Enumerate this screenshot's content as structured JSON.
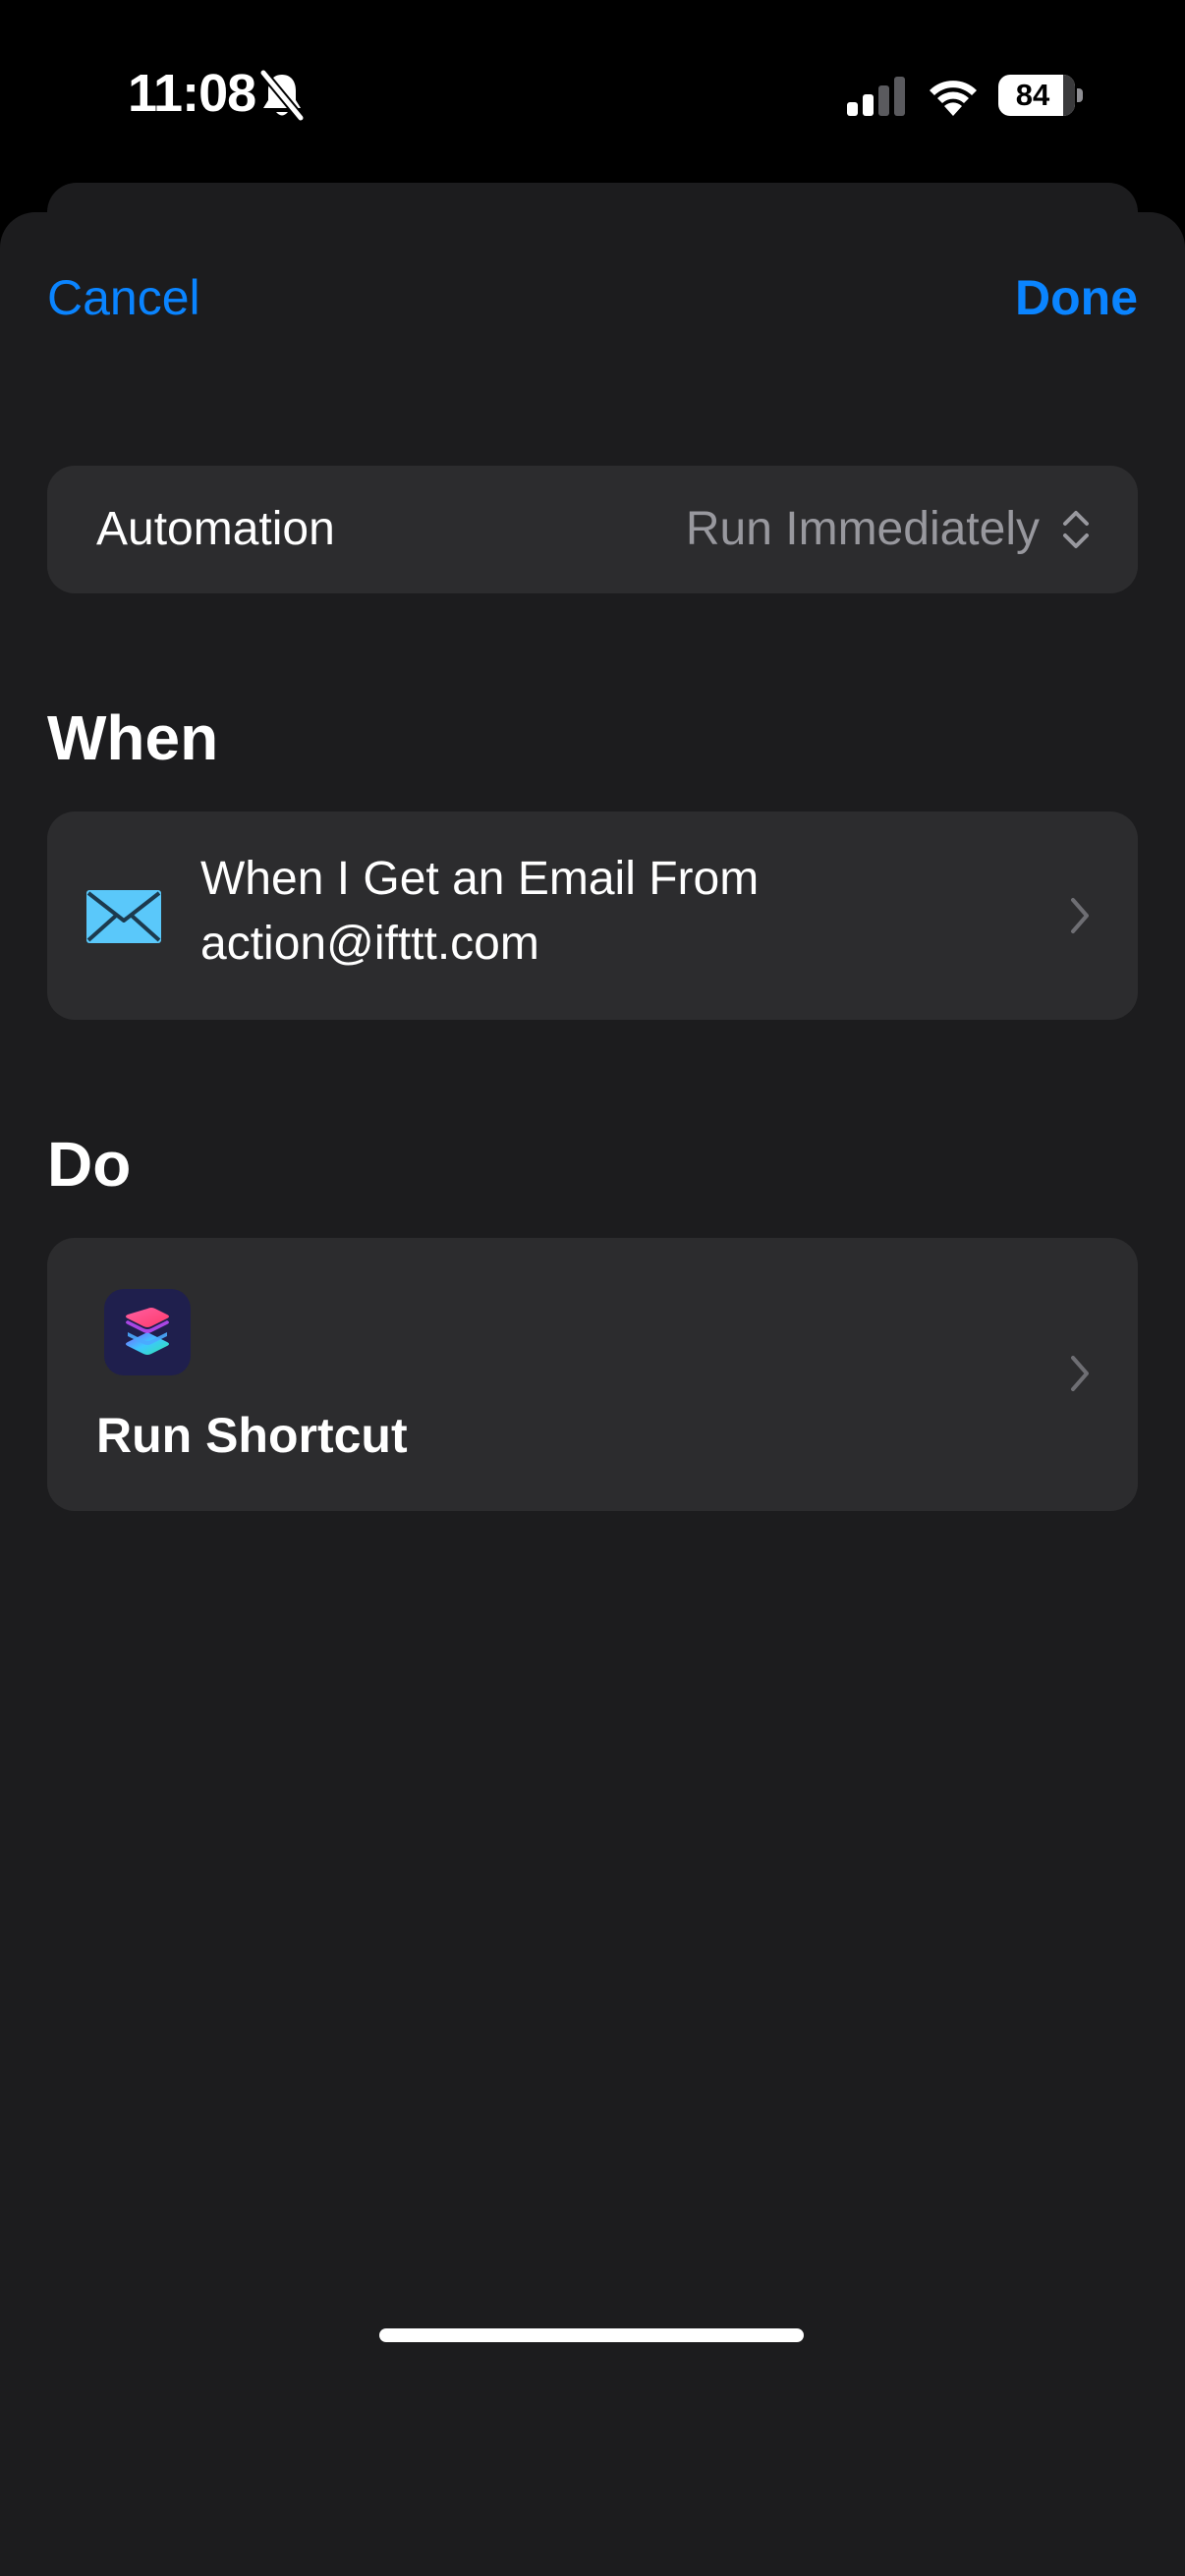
{
  "status_bar": {
    "time": "11:08",
    "battery_percent": "84",
    "battery_level": 0.84,
    "silent_mode": true
  },
  "nav": {
    "cancel_label": "Cancel",
    "done_label": "Done"
  },
  "automation": {
    "label": "Automation",
    "value": "Run Immediately"
  },
  "when": {
    "title": "When",
    "trigger_line1": "When I Get an Email From",
    "trigger_line2": "action@ifttt.com",
    "icon": "mail-icon"
  },
  "do": {
    "title": "Do",
    "action_label": "Run Shortcut",
    "icon": "shortcuts-app-icon"
  },
  "colors": {
    "accent": "#0a84ff",
    "sheet_background": "#1c1c1e",
    "card_background": "#2c2c2e",
    "secondary_text": "#98989e"
  }
}
